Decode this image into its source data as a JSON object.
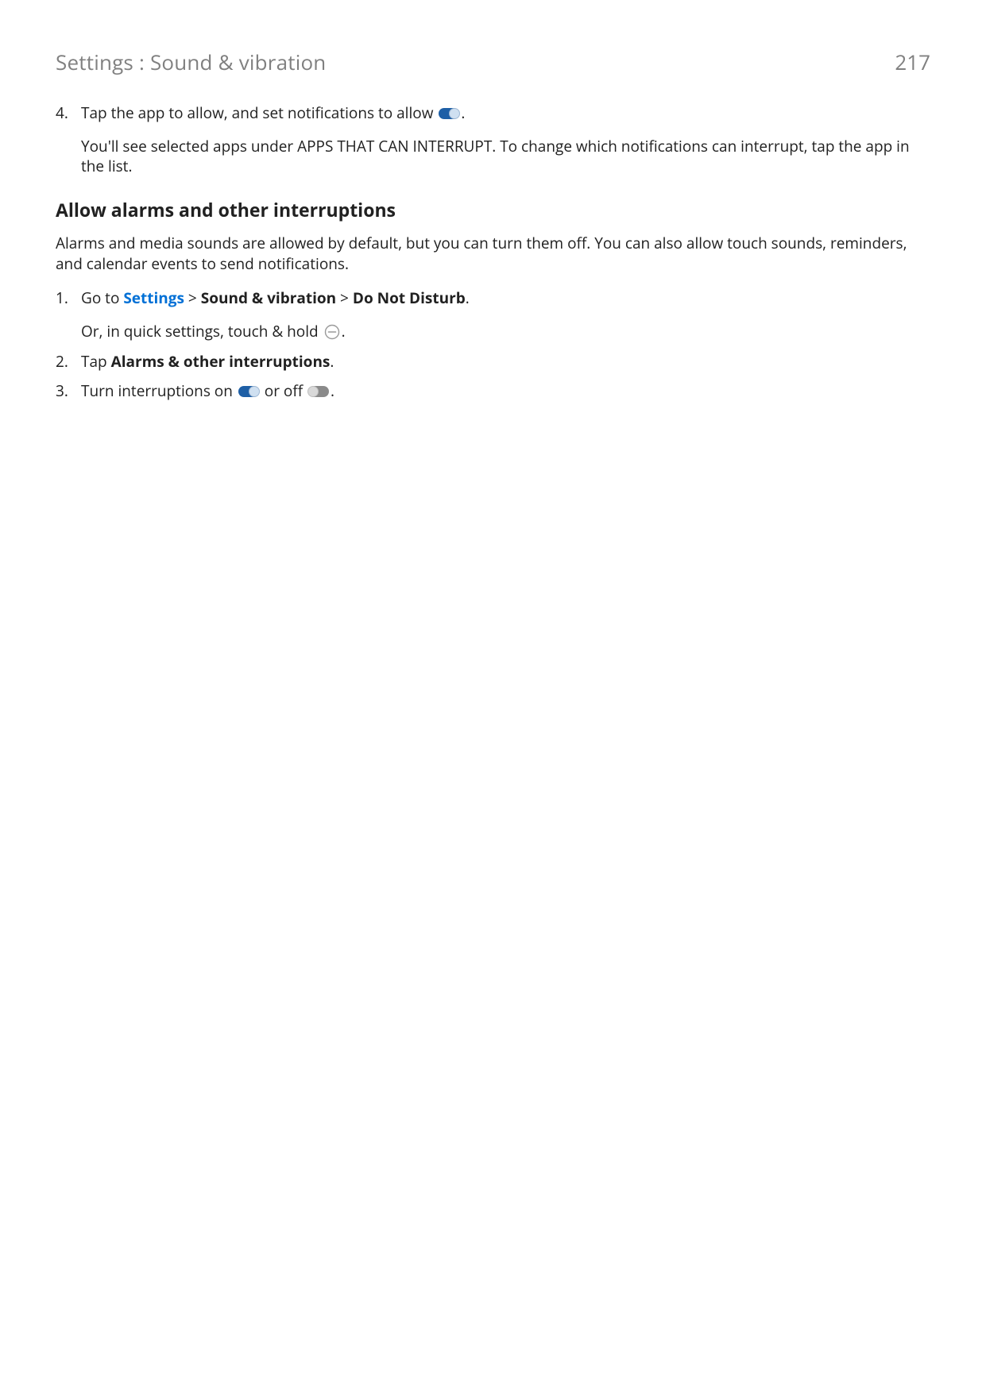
{
  "header": {
    "title": "Settings : Sound & vibration",
    "page_number": "217"
  },
  "step4": {
    "num": "4.",
    "line1_a": "Tap the app to allow, and set notifications to allow ",
    "line1_b": ".",
    "sub": "You'll see selected apps under APPS THAT CAN INTERRUPT. To change which notifications can interrupt, tap the app in the list."
  },
  "section_title": "Allow alarms and other interruptions",
  "lead": "Alarms and media sounds are allowed by default, but you can turn them off. You can also allow touch sounds, reminders, and calendar events to send notifications.",
  "s1": {
    "num": "1.",
    "goto": "Go to ",
    "settings": "Settings",
    "sep1": " > ",
    "sv": "Sound & vibration",
    "sep2": " > ",
    "dnd": "Do Not Disturb",
    "dot": ".",
    "sub_a": "Or, in quick settings, touch & hold ",
    "sub_b": "."
  },
  "s2": {
    "num": "2.",
    "a": "Tap ",
    "b": "Alarms & other interruptions",
    "c": "."
  },
  "s3": {
    "num": "3.",
    "a": "Turn interruptions on ",
    "b": " or off ",
    "c": "."
  }
}
